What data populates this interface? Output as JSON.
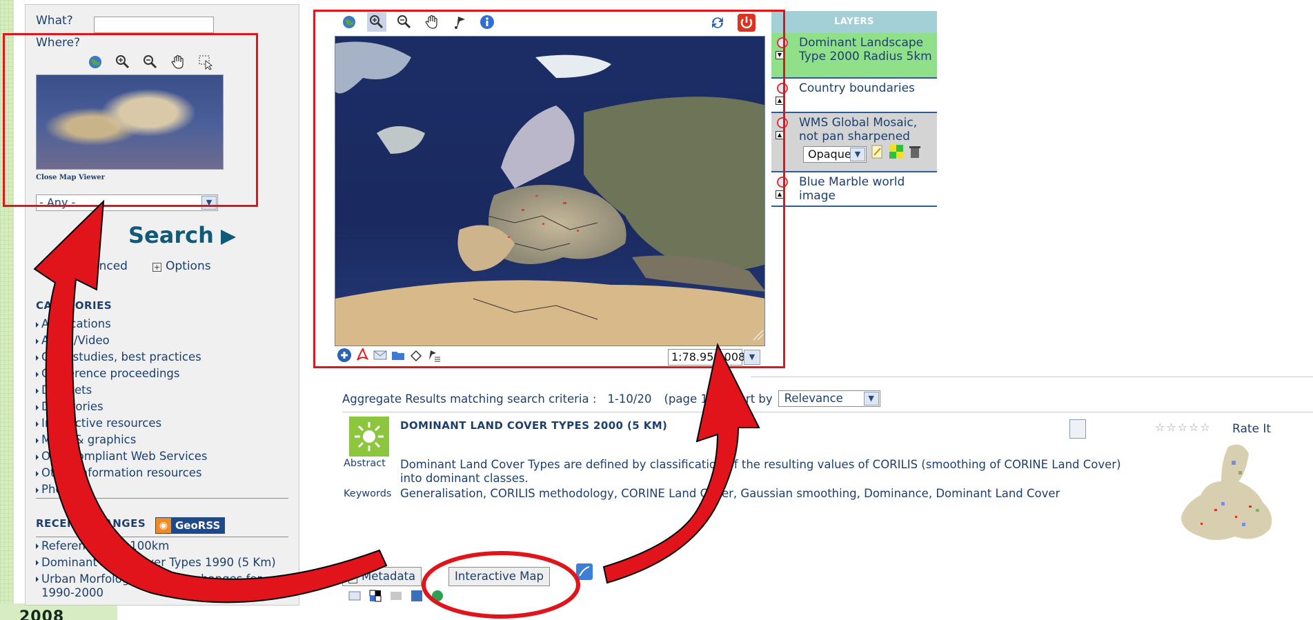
{
  "search": {
    "what_label": "What?",
    "where_label": "Where?",
    "close_map_label": "Close Map Viewer",
    "any_value": "- Any -",
    "search_label": "Search",
    "advanced_label": "Advanced",
    "options_label": "Options"
  },
  "categories": {
    "title": "CATEGORIES",
    "items": [
      "Applications",
      "Audio/Video",
      "Case studies, best practices",
      "Conference proceedings",
      "Datasets",
      "Directories",
      "Interactive resources",
      "Maps & graphics",
      "OGC compliant Web Services",
      "Other information resources",
      "Photo"
    ]
  },
  "recent": {
    "title": "RECENT CHANGES",
    "georss_label": "GeoRSS",
    "items": [
      "Reference Grid 100km",
      "Dominant Land Cover Types 1990 (5 Km)",
      "Urban Morfological Zones, changes for 1990-2000"
    ]
  },
  "map": {
    "scale_value": "1:78.959.008"
  },
  "layers": {
    "title": "LAYERS",
    "items": [
      {
        "name": "Dominant Landscape Type 2000 Radius 5km"
      },
      {
        "name": "Country boundaries"
      },
      {
        "name": "WMS Global Mosaic, not pan sharpened",
        "opacity": "Opaque"
      },
      {
        "name": "Blue Marble world image"
      }
    ]
  },
  "results": {
    "aggregate_label": "Aggregate Results matching search criteria :",
    "range": "1-10/20",
    "page": "(page 1/2)",
    "sort_label": "Sort by",
    "sort_value": "Relevance",
    "item": {
      "title": "DOMINANT LAND COVER TYPES 2000 (5 KM)",
      "abstract_label": "Abstract",
      "abstract": "Dominant Land Cover Types are defined by classification of the resulting values of CORILIS (smoothing of CORINE Land Cover) into dominant classes.",
      "keywords_label": "Keywords",
      "keywords": "Generalisation, CORILIS methodology, CORINE Land Cover, Gaussian smoothing, Dominance, Dominant Land Cover",
      "rate_label": "Rate It",
      "metadata_label": "Metadata",
      "interactive_map_label": "Interactive Map"
    }
  },
  "footer": {
    "logo_text": "2008"
  },
  "colors": {
    "highlight_red": "#e0141a",
    "link_blue": "#1c3f6e",
    "layer_active_green": "#90e08a",
    "layers_header": "#a3cfd7"
  }
}
